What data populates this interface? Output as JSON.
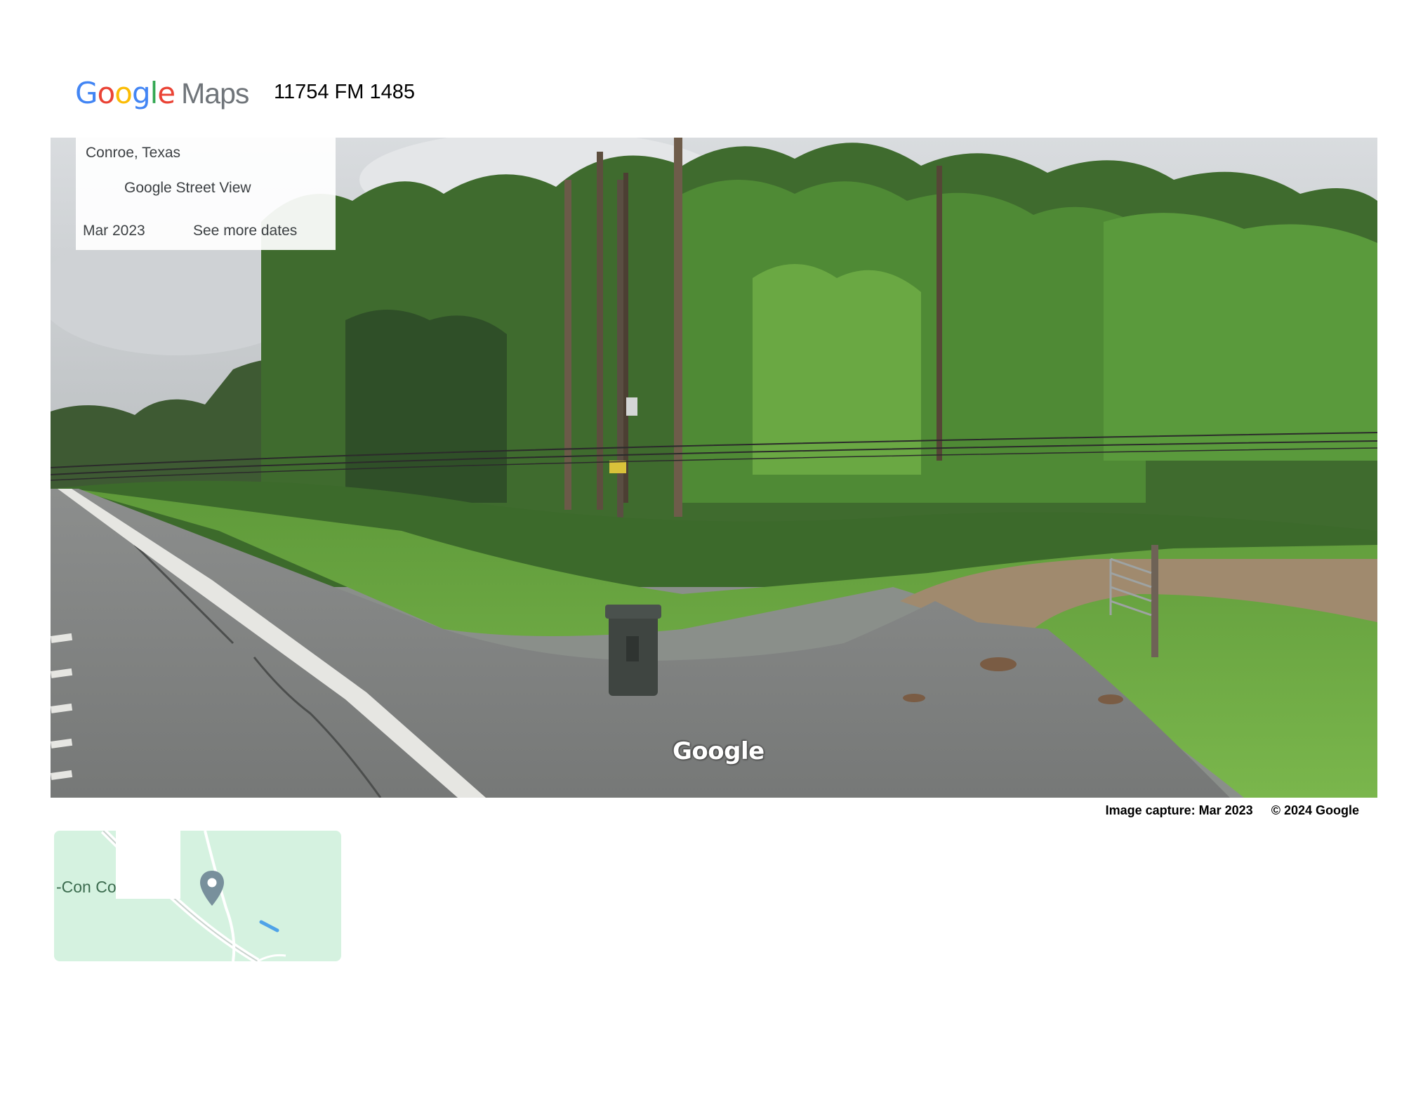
{
  "header": {
    "logo": {
      "g1": "G",
      "o1": "o",
      "o2": "o",
      "g2": "g",
      "l": "l",
      "e": "e",
      "maps": "Maps"
    },
    "address": "11754 FM 1485"
  },
  "street_view": {
    "location": "Conroe, Texas",
    "source_label": "Google Street View",
    "capture_date": "Mar 2023",
    "more_dates_label": "See more dates",
    "watermark": "Google"
  },
  "attribution": {
    "image_capture": "Image capture: Mar 2023",
    "copyright": "© 2024 Google"
  },
  "minimap": {
    "poi_label": "-Con Co      rs",
    "pin_icon": "map-pin-icon"
  },
  "colors": {
    "google_blue": "#4285F4",
    "google_red": "#EA4335",
    "google_yellow": "#FBBC05",
    "google_green": "#34A853",
    "map_green": "#d5f2e0",
    "pin_gray": "#78909c"
  }
}
